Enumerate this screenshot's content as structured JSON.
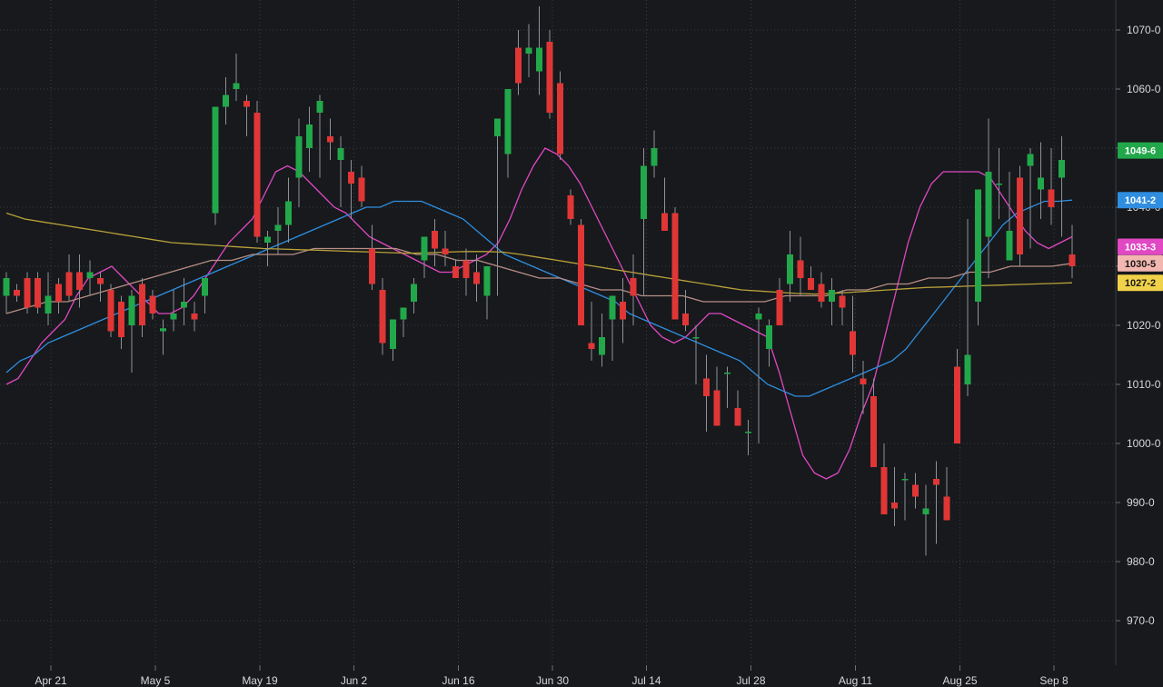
{
  "chart_data": {
    "type": "candlestick",
    "grid": true,
    "y_axis_position": "right",
    "ylim": [
      964,
      1080
    ],
    "y_ticks": [
      {
        "value": 970,
        "label": "970-0"
      },
      {
        "value": 980,
        "label": "980-0"
      },
      {
        "value": 990,
        "label": "990-0"
      },
      {
        "value": 1000,
        "label": "1000-0"
      },
      {
        "value": 1010,
        "label": "1010-0"
      },
      {
        "value": 1020,
        "label": "1020-0"
      },
      {
        "value": 1030,
        "label": "1030-0"
      },
      {
        "value": 1040,
        "label": "1040-0"
      },
      {
        "value": 1050,
        "label": "1050-0"
      },
      {
        "value": 1060,
        "label": "1060-0"
      },
      {
        "value": 1070,
        "label": "1070-0"
      }
    ],
    "x_ticks": [
      {
        "index": 2,
        "label": "Apr 21"
      },
      {
        "index": 12,
        "label": "May 5"
      },
      {
        "index": 22,
        "label": "May 19"
      },
      {
        "index": 31,
        "label": "Jun 2"
      },
      {
        "index": 41,
        "label": "Jun 16"
      },
      {
        "index": 50,
        "label": "Jun 30"
      },
      {
        "index": 59,
        "label": "Jul 14"
      },
      {
        "index": 69,
        "label": "Jul 28"
      },
      {
        "index": 79,
        "label": "Aug 11"
      },
      {
        "index": 89,
        "label": "Aug 25"
      },
      {
        "index": 98,
        "label": "Sep 8"
      }
    ],
    "candles": [
      [
        1025,
        1029,
        1022,
        1028
      ],
      [
        1026,
        1027,
        1024,
        1025
      ],
      [
        1028,
        1029,
        1022,
        1023
      ],
      [
        1028,
        1029,
        1022,
        1023
      ],
      [
        1022,
        1029,
        1020,
        1025
      ],
      [
        1027,
        1028,
        1022,
        1024
      ],
      [
        1029,
        1032,
        1024,
        1025
      ],
      [
        1029,
        1032,
        1023,
        1026
      ],
      [
        1028,
        1031,
        1025,
        1029
      ],
      [
        1028,
        1029,
        1024,
        1027
      ],
      [
        1026,
        1027,
        1018,
        1019
      ],
      [
        1024,
        1025,
        1016,
        1018
      ],
      [
        1020,
        1026,
        1012,
        1025
      ],
      [
        1027,
        1028,
        1018,
        1020
      ],
      [
        1025,
        1026,
        1021,
        1022
      ],
      [
        1019,
        1021,
        1015,
        1019.5
      ],
      [
        1021,
        1026,
        1019,
        1022
      ],
      [
        1023,
        1028,
        1020,
        1024
      ],
      [
        1022,
        1024,
        1019,
        1021
      ],
      [
        1025,
        1028,
        1022,
        1028
      ],
      [
        1039,
        1046,
        1037,
        1057
      ],
      [
        1057,
        1062,
        1054,
        1059
      ],
      [
        1060,
        1066,
        1058,
        1061
      ],
      [
        1058,
        1059,
        1052,
        1057
      ],
      [
        1056,
        1058,
        1034,
        1035
      ],
      [
        1034,
        1036,
        1030,
        1035
      ],
      [
        1036,
        1040,
        1032,
        1037
      ],
      [
        1037,
        1045,
        1034,
        1041
      ],
      [
        1045,
        1055,
        1040,
        1052
      ],
      [
        1050,
        1057,
        1046,
        1054
      ],
      [
        1056,
        1059,
        1045,
        1058
      ],
      [
        1052,
        1055,
        1048,
        1051
      ],
      [
        1048,
        1052,
        1040,
        1050
      ],
      [
        1046,
        1048,
        1038,
        1044
      ],
      [
        1045,
        1047,
        1040,
        1041
      ],
      [
        1033,
        1037,
        1026,
        1027
      ],
      [
        1026,
        1028,
        1015,
        1017
      ],
      [
        1016,
        1020,
        1014,
        1021
      ],
      [
        1021,
        1023,
        1018,
        1023
      ],
      [
        1024,
        1028,
        1022,
        1027
      ],
      [
        1031,
        1034,
        1028,
        1035
      ],
      [
        1036,
        1038,
        1030,
        1033
      ],
      [
        1033,
        1036,
        1030,
        1032
      ],
      [
        1030,
        1031,
        1028,
        1028
      ],
      [
        1031,
        1033,
        1025,
        1028
      ],
      [
        1029,
        1032,
        1024,
        1027
      ],
      [
        1025,
        1028,
        1021,
        1030
      ],
      [
        1052,
        1055,
        1025,
        1055
      ],
      [
        1049,
        1059,
        1045,
        1060
      ],
      [
        1067,
        1070,
        1059,
        1061
      ],
      [
        1066,
        1071,
        1062,
        1067
      ],
      [
        1063,
        1074,
        1059,
        1067
      ],
      [
        1068,
        1070,
        1055,
        1056
      ],
      [
        1061,
        1063,
        1048,
        1049
      ],
      [
        1042,
        1043,
        1037,
        1038
      ],
      [
        1037,
        1038,
        1022,
        1020
      ],
      [
        1017,
        1024,
        1014,
        1016
      ],
      [
        1015,
        1022,
        1013,
        1018
      ],
      [
        1021,
        1025,
        1014,
        1025
      ],
      [
        1024,
        1028,
        1017,
        1021
      ],
      [
        1028,
        1032,
        1020,
        1025
      ],
      [
        1038,
        1050,
        1025,
        1047
      ],
      [
        1047,
        1053,
        1045,
        1050
      ],
      [
        1039,
        1045,
        1036,
        1036
      ],
      [
        1039,
        1040,
        1022,
        1021
      ],
      [
        1022,
        1026,
        1019,
        1020
      ],
      [
        1018,
        1020,
        1010,
        1018
      ],
      [
        1011,
        1015,
        1002,
        1008
      ],
      [
        1009,
        1013,
        1003,
        1003
      ],
      [
        1012,
        1013,
        1006,
        1012
      ],
      [
        1006,
        1009,
        1003,
        1003
      ],
      [
        1002,
        1004,
        998,
        1002
      ],
      [
        1021,
        1023,
        1000,
        1022
      ],
      [
        1016,
        1021,
        1013,
        1020
      ],
      [
        1026,
        1028,
        1022,
        1020
      ],
      [
        1027,
        1036,
        1024,
        1032
      ],
      [
        1031,
        1035,
        1025,
        1028
      ],
      [
        1028,
        1030,
        1026,
        1026
      ],
      [
        1027,
        1029,
        1023,
        1024
      ],
      [
        1024,
        1028,
        1020,
        1026
      ],
      [
        1025,
        1026,
        1020,
        1023
      ],
      [
        1019,
        1025,
        1012,
        1015
      ],
      [
        1011,
        1014,
        1005,
        1010
      ],
      [
        1008,
        1011,
        996,
        996
      ],
      [
        996,
        1000,
        988,
        988
      ],
      [
        990,
        996,
        986,
        989
      ],
      [
        994,
        995,
        987,
        994
      ],
      [
        993,
        995,
        989,
        991
      ],
      [
        988,
        993,
        981,
        989
      ],
      [
        994,
        997,
        983,
        993
      ],
      [
        991,
        996,
        987,
        987
      ],
      [
        1013,
        1016,
        1002,
        1000
      ],
      [
        1010,
        1038,
        1008,
        1015
      ],
      [
        1024,
        1035,
        1020,
        1043
      ],
      [
        1035,
        1055,
        1028,
        1046
      ],
      [
        1044,
        1050,
        1038,
        1044
      ],
      [
        1031,
        1046,
        1031,
        1036
      ],
      [
        1045,
        1047,
        1030,
        1032
      ],
      [
        1047,
        1050,
        1033,
        1049
      ],
      [
        1043,
        1051,
        1038,
        1045
      ],
      [
        1043,
        1050,
        1037,
        1040
      ],
      [
        1045,
        1052,
        1035,
        1048
      ],
      [
        1032,
        1037,
        1028,
        1030
      ]
    ],
    "series": [
      {
        "values": [
          1010,
          1011,
          1014,
          1017,
          1019,
          1021,
          1025,
          1028,
          1029,
          1030,
          1028,
          1026,
          1024,
          1022,
          1022,
          1023,
          1025,
          1028,
          1031,
          1034,
          1036,
          1038,
          1042,
          1046,
          1047,
          1046,
          1044,
          1042,
          1040,
          1039,
          1037,
          1035,
          1034,
          1033,
          1032,
          1031,
          1030,
          1029,
          1029,
          1030,
          1031,
          1032,
          1034,
          1038,
          1043,
          1047,
          1050,
          1049,
          1047,
          1044,
          1040,
          1036,
          1032,
          1028,
          1024,
          1020,
          1018,
          1017,
          1018,
          1020,
          1022,
          1022,
          1021,
          1020,
          1019,
          1018,
          1012,
          1005,
          998,
          995,
          994,
          995,
          999,
          1005,
          1010,
          1018,
          1026,
          1034,
          1040,
          1044,
          1046,
          1046,
          1046,
          1046,
          1045,
          1042,
          1039,
          1036,
          1034,
          1033,
          1034,
          1035
        ]
      },
      {
        "values": [
          1012,
          1014,
          1015,
          1017,
          1018,
          1019,
          1020,
          1021,
          1022,
          1023,
          1024,
          1025,
          1026,
          1027,
          1028,
          1029,
          1030,
          1031,
          1032,
          1033,
          1034,
          1035,
          1036,
          1037,
          1038,
          1039,
          1040,
          1040,
          1041,
          1041,
          1041,
          1040,
          1039,
          1038,
          1036,
          1034,
          1032,
          1031,
          1030,
          1029,
          1028,
          1027,
          1026,
          1025,
          1024,
          1022,
          1021,
          1020,
          1019,
          1018,
          1017,
          1016,
          1015,
          1014,
          1012,
          1010,
          1009,
          1008,
          1008,
          1009,
          1010,
          1011,
          1012,
          1013,
          1014,
          1016,
          1019,
          1022,
          1025,
          1028,
          1031,
          1034,
          1037,
          1039,
          1040,
          1041,
          1041,
          1041.2
        ]
      },
      {
        "values": [
          1022,
          1023,
          1024,
          1024,
          1025,
          1026,
          1027,
          1028,
          1029,
          1030,
          1031,
          1031,
          1032,
          1032,
          1032,
          1033,
          1033,
          1033,
          1033,
          1033,
          1032,
          1032,
          1031,
          1031,
          1030,
          1029,
          1028,
          1028,
          1027,
          1026,
          1026,
          1025,
          1025,
          1025,
          1024,
          1024,
          1024,
          1024,
          1025,
          1025,
          1025,
          1026,
          1026,
          1027,
          1027,
          1028,
          1028,
          1029,
          1029,
          1030,
          1030,
          1030,
          1030.5
        ]
      },
      {
        "values": [
          1039,
          1038,
          1037.5,
          1037,
          1036.5,
          1036,
          1035.5,
          1035,
          1034.5,
          1034,
          1033.8,
          1033.6,
          1033.4,
          1033.2,
          1033,
          1032.9,
          1032.8,
          1032.7,
          1032.6,
          1032.5,
          1032.4,
          1032.3,
          1032.2,
          1032.3,
          1032.4,
          1032.5,
          1032.5,
          1032.4,
          1032,
          1031.5,
          1031,
          1030.5,
          1030,
          1029.5,
          1029,
          1028.5,
          1028,
          1027.5,
          1027,
          1026.5,
          1026,
          1025.8,
          1025.6,
          1025.4,
          1025.3,
          1025.4,
          1025.6,
          1025.8,
          1026,
          1026.2,
          1026.4,
          1026.5,
          1026.6,
          1026.7,
          1026.8,
          1026.9,
          1027,
          1027.1,
          1027.2
        ]
      }
    ],
    "value_tags": [
      {
        "label": "1049-6",
        "value": 1049.6,
        "color": "#22a84a",
        "text_color": "#ffffff"
      },
      {
        "label": "1041-2",
        "value": 1041.2,
        "color": "#2f8ee0",
        "text_color": "#ffffff"
      },
      {
        "label": "1033-3",
        "value": 1033.3,
        "color": "#e048c4",
        "text_color": "#ffffff"
      },
      {
        "label": "1030-5",
        "value": 1030.5,
        "color": "#f2b7b0",
        "text_color": "#1a1a1a"
      },
      {
        "label": "1027-2",
        "value": 1027.2,
        "color": "#f0d24a",
        "text_color": "#1a1a1a"
      }
    ],
    "colors": {
      "background": "#17191c",
      "up": "#22a84a",
      "down": "#e03636",
      "wick": "#8e9197",
      "ma_pink": "#e048c4",
      "ma_blue": "#2f8ee0",
      "ma_rose": "#b88e86",
      "ma_gold": "#b9a13a",
      "axis_text": "#d6d8dc",
      "grid": "#3a3d42"
    }
  }
}
